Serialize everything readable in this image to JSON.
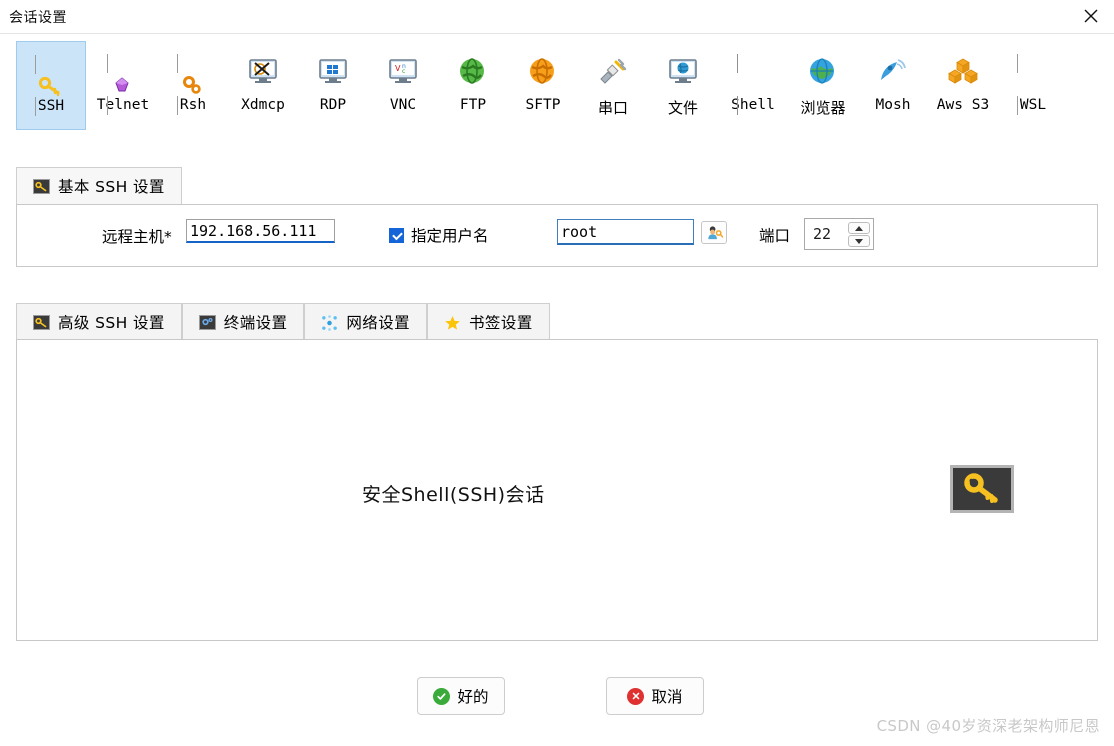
{
  "window": {
    "title": "会话设置",
    "close_icon": "close-icon"
  },
  "session_types": [
    {
      "id": "ssh",
      "label": "SSH",
      "icon": "key-icon",
      "selected": true
    },
    {
      "id": "telnet",
      "label": "Telnet",
      "icon": "purple-gem-icon",
      "selected": false
    },
    {
      "id": "rsh",
      "label": "Rsh",
      "icon": "orange-gears-icon",
      "selected": false
    },
    {
      "id": "xdmcp",
      "label": "Xdmcp",
      "icon": "x-monitor-icon",
      "selected": false
    },
    {
      "id": "rdp",
      "label": "RDP",
      "icon": "windows-monitor-icon",
      "selected": false
    },
    {
      "id": "vnc",
      "label": "VNC",
      "icon": "vnc-monitor-icon",
      "selected": false
    },
    {
      "id": "ftp",
      "label": "FTP",
      "icon": "green-globe-icon",
      "selected": false
    },
    {
      "id": "sftp",
      "label": "SFTP",
      "icon": "orange-globe-icon",
      "selected": false
    },
    {
      "id": "serial",
      "label": "串口",
      "icon": "plug-icon",
      "selected": false
    },
    {
      "id": "file",
      "label": "文件",
      "icon": "globe-monitor-icon",
      "selected": false
    },
    {
      "id": "shell",
      "label": "Shell",
      "icon": "terminal-icon",
      "selected": false
    },
    {
      "id": "browser",
      "label": "浏览器",
      "icon": "blue-globe-icon",
      "selected": false
    },
    {
      "id": "mosh",
      "label": "Mosh",
      "icon": "satellite-dish-icon",
      "selected": false
    },
    {
      "id": "awss3",
      "label": "Aws S3",
      "icon": "aws-cubes-icon",
      "selected": false
    },
    {
      "id": "wsl",
      "label": "WSL",
      "icon": "windows-icon",
      "selected": false
    }
  ],
  "basic": {
    "tab_label": "基本 SSH 设置",
    "tab_icon": "key-icon",
    "host_label": "远程主机*",
    "host_value": "192.168.56.111",
    "specify_user_label": "指定用户名",
    "specify_user_checked": true,
    "user_value": "root",
    "user_button_icon": "user-key-icon",
    "port_label": "端口",
    "port_value": "22",
    "spin_up_icon": "caret-up-icon",
    "spin_down_icon": "caret-down-icon"
  },
  "advanced_tabs": [
    {
      "id": "advanced-ssh",
      "label": "高级 SSH 设置",
      "icon": "key-icon"
    },
    {
      "id": "terminal",
      "label": "终端设置",
      "icon": "terminal-settings-icon"
    },
    {
      "id": "network",
      "label": "网络设置",
      "icon": "network-nodes-icon"
    },
    {
      "id": "bookmark",
      "label": "书签设置",
      "icon": "star-icon"
    }
  ],
  "content": {
    "caption": "安全Shell(SSH)会话",
    "badge_icon": "big-key-icon"
  },
  "footer": {
    "ok_label": "好的",
    "ok_icon": "check-circle-icon",
    "cancel_label": "取消",
    "cancel_icon": "x-circle-icon"
  },
  "watermark": {
    "text": "CSDN @40岁资深老架构师尼恩"
  },
  "colors": {
    "selected_tab_bg": "#cce4f8",
    "selected_tab_border": "#9ecbee",
    "focus_underline": "#1464c8",
    "checkbox_blue": "#1565d8",
    "ok_green": "#3aab3a",
    "cancel_red": "#e03131",
    "key_yellow": "#f5c020"
  }
}
